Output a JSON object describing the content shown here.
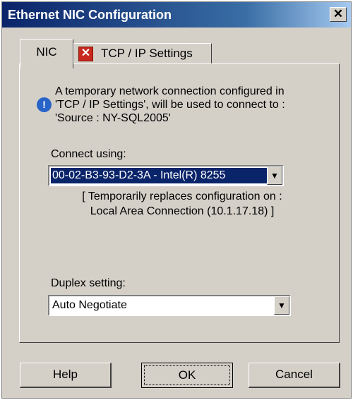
{
  "window": {
    "title": "Ethernet NIC Configuration",
    "close_glyph": "✕"
  },
  "tabs": [
    {
      "label": "NIC",
      "active": true
    },
    {
      "label": "TCP / IP Settings",
      "icon": "error-x-icon"
    }
  ],
  "info": {
    "icon": "info-icon",
    "lines": [
      "A temporary network connection configured in",
      "'TCP / IP Settings', will be used to connect to :",
      "'Source : NY-SQL2005'"
    ]
  },
  "connect": {
    "label": "Connect using:",
    "value": "00-02-B3-93-D2-3A  -  Intel(R)  8255",
    "note_lines": [
      "[ Temporarily replaces configuration on :",
      "Local Area Connection (10.1.17.18) ]"
    ]
  },
  "duplex": {
    "label": "Duplex setting:",
    "value": "Auto Negotiate"
  },
  "buttons": {
    "help": "Help",
    "ok": "OK",
    "cancel": "Cancel"
  },
  "colors": {
    "titlebar_start": "#0a246a",
    "titlebar_end": "#a6caf0",
    "face": "#d4d0c8",
    "error": "#c8281e",
    "info": "#2864c8"
  }
}
